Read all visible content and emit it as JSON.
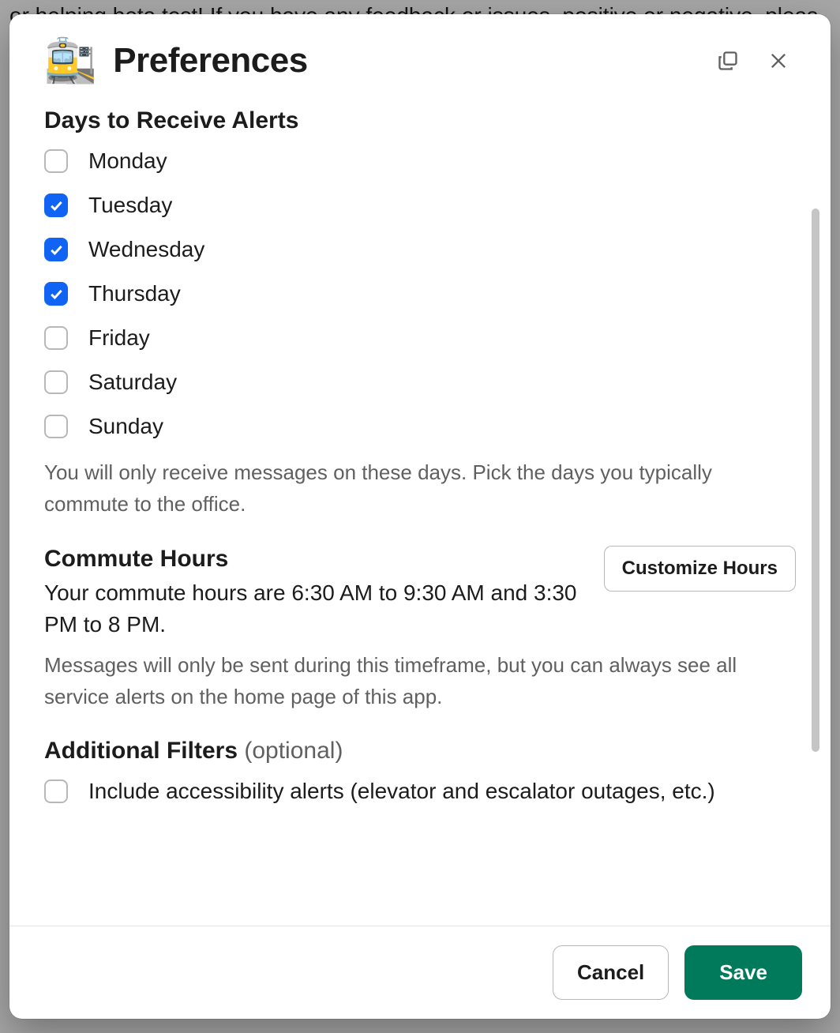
{
  "backdrop_text": "or helping beta test! If you have any feedback or issues, positive or negative, pleas",
  "modal": {
    "title": "Preferences",
    "icon": "🚉"
  },
  "days_section": {
    "heading": "Days to Receive Alerts",
    "items": [
      {
        "label": "Monday",
        "checked": false
      },
      {
        "label": "Tuesday",
        "checked": true
      },
      {
        "label": "Wednesday",
        "checked": true
      },
      {
        "label": "Thursday",
        "checked": true
      },
      {
        "label": "Friday",
        "checked": false
      },
      {
        "label": "Saturday",
        "checked": false
      },
      {
        "label": "Sunday",
        "checked": false
      }
    ],
    "help": "You will only receive messages on these days. Pick the days you typically commute to the office."
  },
  "commute_section": {
    "heading": "Commute Hours",
    "desc": "Your commute hours are 6:30 AM to 9:30 AM and 3:30 PM to 8 PM.",
    "button": "Customize Hours",
    "help": "Messages will only be sent during this timeframe, but you can always see all service alerts on the home page of this app."
  },
  "filters_section": {
    "heading": "Additional Filters ",
    "optional": "(optional)",
    "items": [
      {
        "label": "Include accessibility alerts (elevator and escalator outages, etc.)",
        "checked": false
      }
    ]
  },
  "footer": {
    "cancel": "Cancel",
    "save": "Save"
  }
}
